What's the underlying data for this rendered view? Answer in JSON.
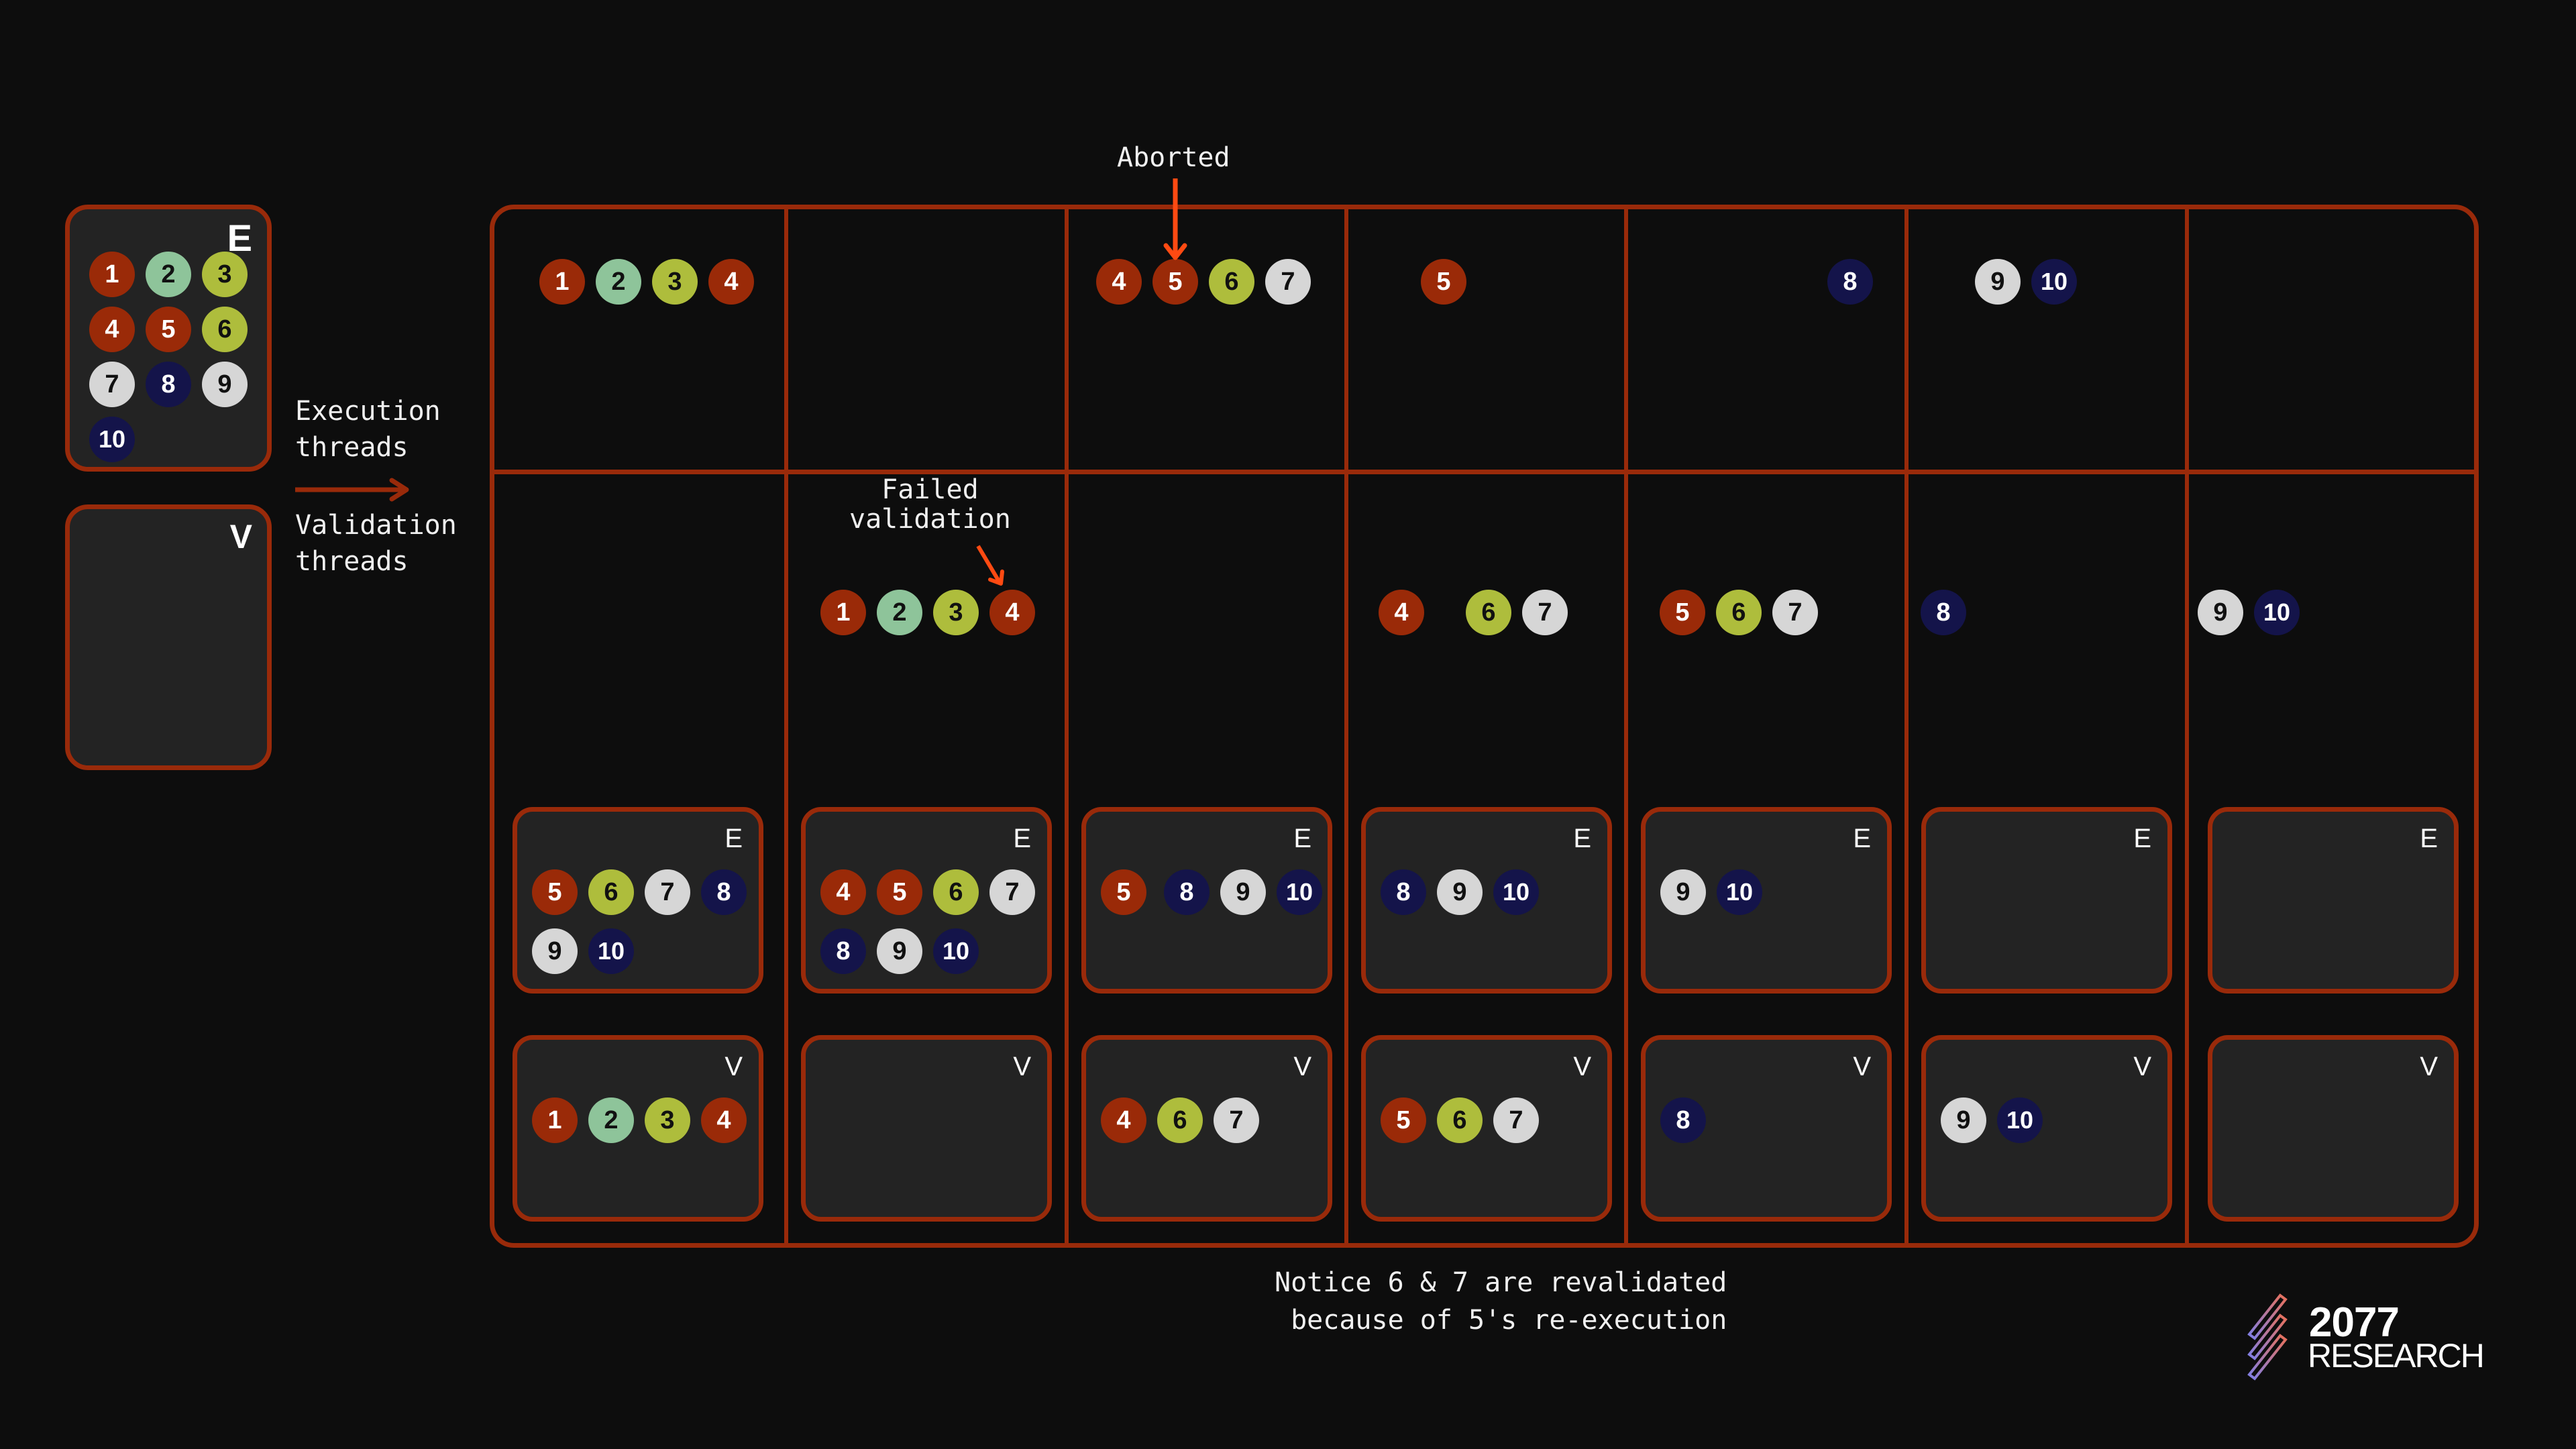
{
  "colors": {
    "background": "#0d0d0d",
    "border": "#992a0a",
    "panel_bg": "#232323",
    "annotation_arrow": "#ff4a12",
    "ball_palette": {
      "1": {
        "fill": "#9a2a08",
        "text": "#ffffff"
      },
      "2": {
        "fill": "#8ec49a",
        "text": "#111111"
      },
      "3": {
        "fill": "#aebd3c",
        "text": "#111111"
      },
      "4": {
        "fill": "#9a2a08",
        "text": "#ffffff"
      },
      "5": {
        "fill": "#9a2a08",
        "text": "#ffffff"
      },
      "6": {
        "fill": "#aebd3c",
        "text": "#111111"
      },
      "7": {
        "fill": "#d6d6d6",
        "text": "#111111"
      },
      "8": {
        "fill": "#14144a",
        "text": "#ffffff"
      },
      "9": {
        "fill": "#d6d6d6",
        "text": "#111111"
      },
      "10": {
        "fill": "#14144a",
        "text": "#ffffff"
      }
    }
  },
  "legend": {
    "execution_panel": {
      "tag": "E",
      "balls": [
        1,
        2,
        3,
        4,
        5,
        6,
        7,
        8,
        9,
        10
      ]
    },
    "validation_panel": {
      "tag": "V",
      "balls": []
    },
    "execution_label": "Execution\nthreads",
    "validation_label": "Validation\nthreads"
  },
  "annotations": {
    "aborted": "Aborted",
    "failed_validation": "Failed\nvalidation",
    "footer_note": "Notice 6 & 7 are revalidated\nbecause of 5's re-execution"
  },
  "timeline": {
    "steps": [
      {
        "executing": [
          1,
          2,
          3,
          4
        ],
        "validating": [],
        "exec_pool": {
          "tag": "E",
          "balls": [
            5,
            6,
            7,
            8,
            9,
            10
          ]
        },
        "valid_pool": {
          "tag": "V",
          "balls": [
            1,
            2,
            3,
            4
          ]
        }
      },
      {
        "executing": [],
        "validating": [
          1,
          2,
          3,
          4
        ],
        "exec_pool": {
          "tag": "E",
          "balls": [
            4,
            5,
            6,
            7,
            8,
            9,
            10
          ]
        },
        "valid_pool": {
          "tag": "V",
          "balls": []
        }
      },
      {
        "executing": [
          4,
          5,
          6,
          7
        ],
        "validating": [],
        "exec_pool": {
          "tag": "E",
          "balls": [
            5,
            8,
            9,
            10
          ]
        },
        "valid_pool": {
          "tag": "V",
          "balls": [
            4,
            6,
            7
          ]
        }
      },
      {
        "executing": [
          5
        ],
        "validating": [
          4,
          6,
          7
        ],
        "exec_pool": {
          "tag": "E",
          "balls": [
            8,
            9,
            10
          ]
        },
        "valid_pool": {
          "tag": "V",
          "balls": [
            5,
            6,
            7
          ]
        }
      },
      {
        "executing": [
          8
        ],
        "validating": [
          5,
          6,
          7
        ],
        "exec_pool": {
          "tag": "E",
          "balls": [
            9,
            10
          ]
        },
        "valid_pool": {
          "tag": "V",
          "balls": [
            8
          ]
        }
      },
      {
        "executing": [
          9,
          10
        ],
        "validating": [
          8
        ],
        "exec_pool": {
          "tag": "E",
          "balls": []
        },
        "valid_pool": {
          "tag": "V",
          "balls": [
            9,
            10
          ]
        }
      },
      {
        "executing": [],
        "validating": [
          9,
          10
        ],
        "exec_pool": {
          "tag": "E",
          "balls": []
        },
        "valid_pool": {
          "tag": "V",
          "balls": []
        }
      }
    ]
  },
  "logo": {
    "line1": "2077",
    "line2": "RESEARCH"
  }
}
